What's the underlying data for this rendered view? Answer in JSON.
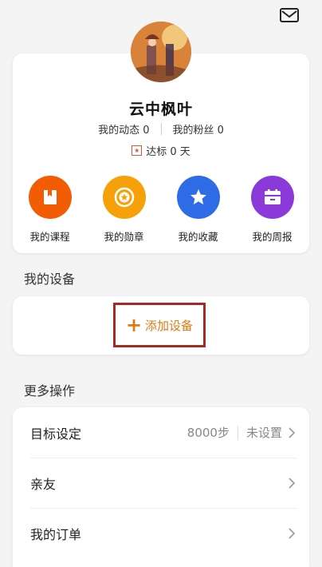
{
  "profile": {
    "name": "云中枫叶",
    "stats": [
      {
        "label": "我的动态",
        "value": "0"
      },
      {
        "label": "我的粉丝",
        "value": "0"
      }
    ],
    "badge_text": "达标 0 天"
  },
  "shortcuts": [
    {
      "label": "我的课程",
      "color": "#f25c05",
      "icon": "book-icon"
    },
    {
      "label": "我的勋章",
      "color": "#f7a10a",
      "icon": "medal-icon"
    },
    {
      "label": "我的收藏",
      "color": "#2e6be6",
      "icon": "star-icon"
    },
    {
      "label": "我的周报",
      "color": "#8b3ad9",
      "icon": "calendar-icon"
    }
  ],
  "devices": {
    "title": "我的设备",
    "add_label": "添加设备"
  },
  "more": {
    "title": "更多操作",
    "rows": [
      {
        "label": "目标设定",
        "value": "8000步",
        "status": "未设置"
      },
      {
        "label": "亲友"
      },
      {
        "label": "我的订单"
      }
    ]
  },
  "colors": {
    "accent": "#e07b14",
    "highlight_border": "#a42a24"
  }
}
